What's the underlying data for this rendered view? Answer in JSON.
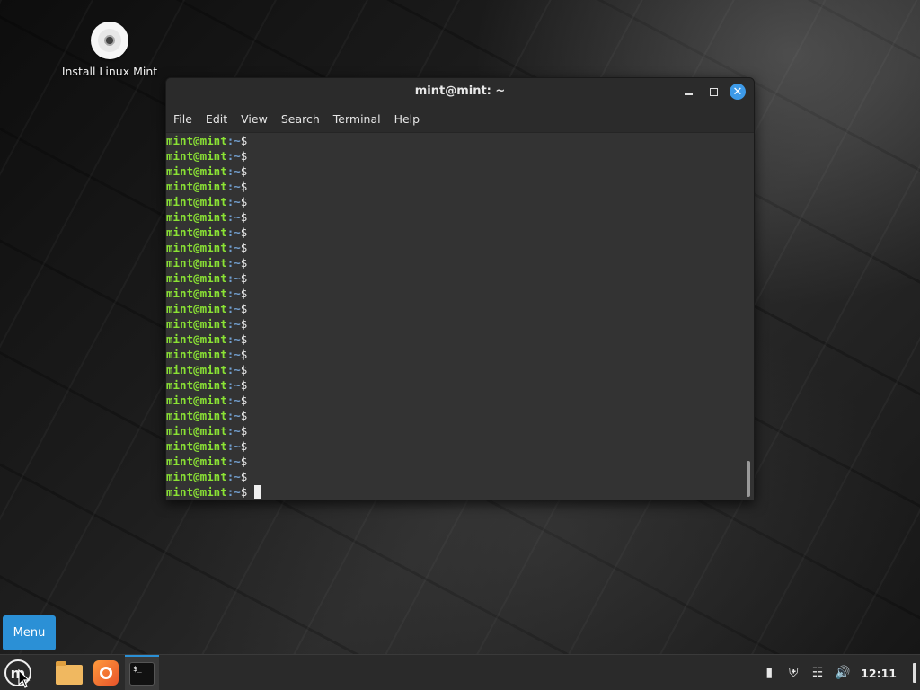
{
  "desktop": {
    "icon_label": "Install Linux Mint"
  },
  "window": {
    "title": "mint@mint: ~",
    "menu": [
      "File",
      "Edit",
      "View",
      "Search",
      "Terminal",
      "Help"
    ]
  },
  "terminal": {
    "user": "mint@mint",
    "path": ":~",
    "prompt": "$",
    "line_count": 24
  },
  "menu_tooltip": {
    "label": "Menu"
  },
  "taskbar": {
    "clock": "12:11",
    "active_app": "terminal"
  },
  "colors": {
    "accent": "#2b90d6",
    "prompt_user": "#8ae234",
    "prompt_path": "#729fcf",
    "close_button": "#3d9ae8"
  },
  "icons": {
    "disc": "disc-icon",
    "mint": "mint-logo-icon",
    "files": "folder-icon",
    "firefox": "firefox-icon",
    "terminal": "terminal-icon",
    "tray": [
      "notification-icon",
      "shield-icon",
      "network-icon",
      "volume-icon"
    ]
  }
}
